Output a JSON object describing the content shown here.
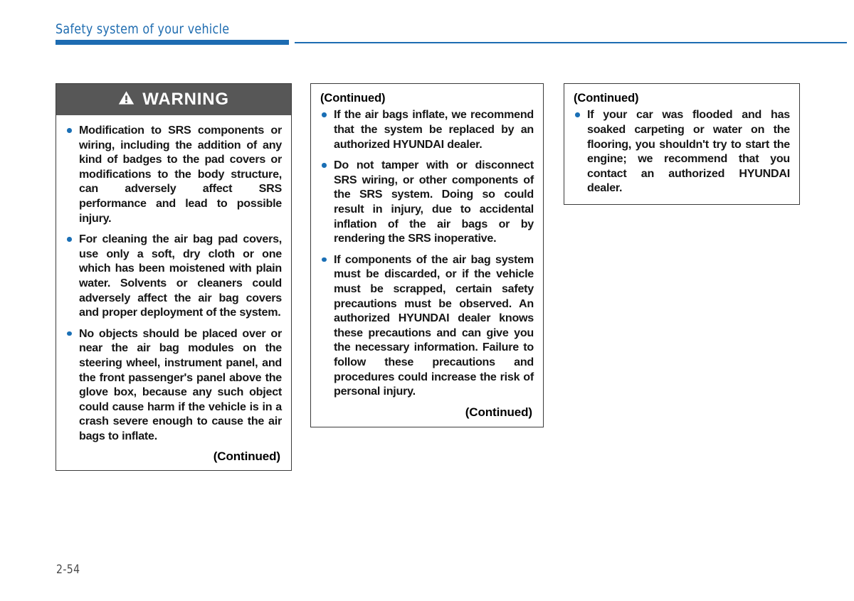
{
  "header": {
    "title": "Safety system of your vehicle",
    "accent_color": "#1d6cb2"
  },
  "folio": {
    "page_number": "2-54"
  },
  "columns": [
    {
      "id": "col1",
      "type": "warning",
      "warning_label": "WARNING",
      "warning_icon": "warning-triangle-icon",
      "header_bg": "#575757",
      "bullets": [
        "Modification to SRS components or wiring, including the addition of any kind of badges to the pad covers or modifications to the body structure, can adversely affect SRS performance and lead to possible injury.",
        "For cleaning the air bag pad covers, use only a soft, dry cloth or one which has been moistened with plain water. Solvents or cleaners could adversely affect the air bag covers and proper deployment of the system.",
        "No objects should be placed over or near the air bag modules on the steering wheel, instrument panel, and the front passenger's panel above the glove box, because any such object could cause harm if the vehicle is in a crash severe enough to cause the air bags to inflate."
      ],
      "continued_bottom": "(Continued)"
    },
    {
      "id": "col2",
      "type": "continued",
      "continued_top": "(Continued)",
      "bullets": [
        "If the air bags inflate, we recommend that the system be replaced by an authorized HYUNDAI dealer.",
        "Do not tamper with or disconnect SRS wiring, or other components of the SRS system. Doing so could result in injury, due to accidental inflation of the air bags or by rendering the SRS inoperative.",
        "If components of the air bag system must be discarded, or if the vehicle must be scrapped, certain safety precautions must be observed. An authorized HYUNDAI dealer knows these precautions and can give you the necessary information. Failure to follow these precautions and procedures could increase the risk of personal injury."
      ],
      "continued_bottom": "(Continued)"
    },
    {
      "id": "col3",
      "type": "continued",
      "continued_top": "(Continued)",
      "bullets": [
        "If your car was flooded and has soaked carpeting or water on the flooring, you shouldn't try to start the engine; we recommend that you contact an authorized HYUNDAI dealer."
      ]
    }
  ],
  "bullet_color": "#1a6fb5"
}
